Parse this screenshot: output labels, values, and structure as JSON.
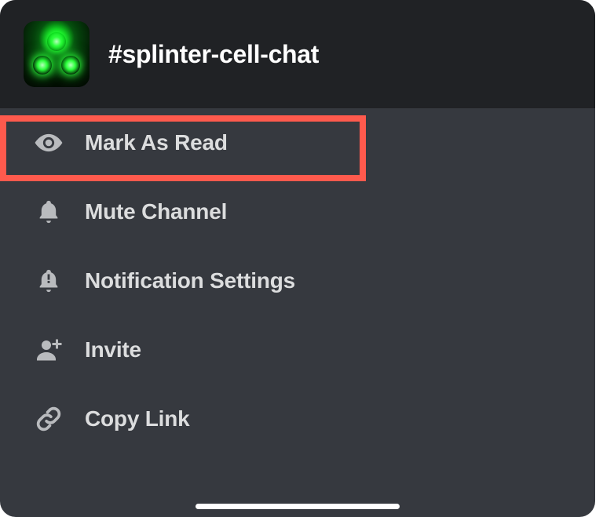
{
  "header": {
    "channel_title": "#splinter-cell-chat"
  },
  "menu": {
    "items": [
      {
        "id": "mark-as-read",
        "label": "Mark As Read",
        "icon": "eye-icon",
        "highlighted": true
      },
      {
        "id": "mute-channel",
        "label": "Mute Channel",
        "icon": "bell-icon",
        "highlighted": false
      },
      {
        "id": "notification-settings",
        "label": "Notification Settings",
        "icon": "bell-alert-icon",
        "highlighted": false
      },
      {
        "id": "invite",
        "label": "Invite",
        "icon": "person-add-icon",
        "highlighted": false
      },
      {
        "id": "copy-link",
        "label": "Copy Link",
        "icon": "link-icon",
        "highlighted": false
      }
    ]
  },
  "highlight_color": "#ff5a4d"
}
